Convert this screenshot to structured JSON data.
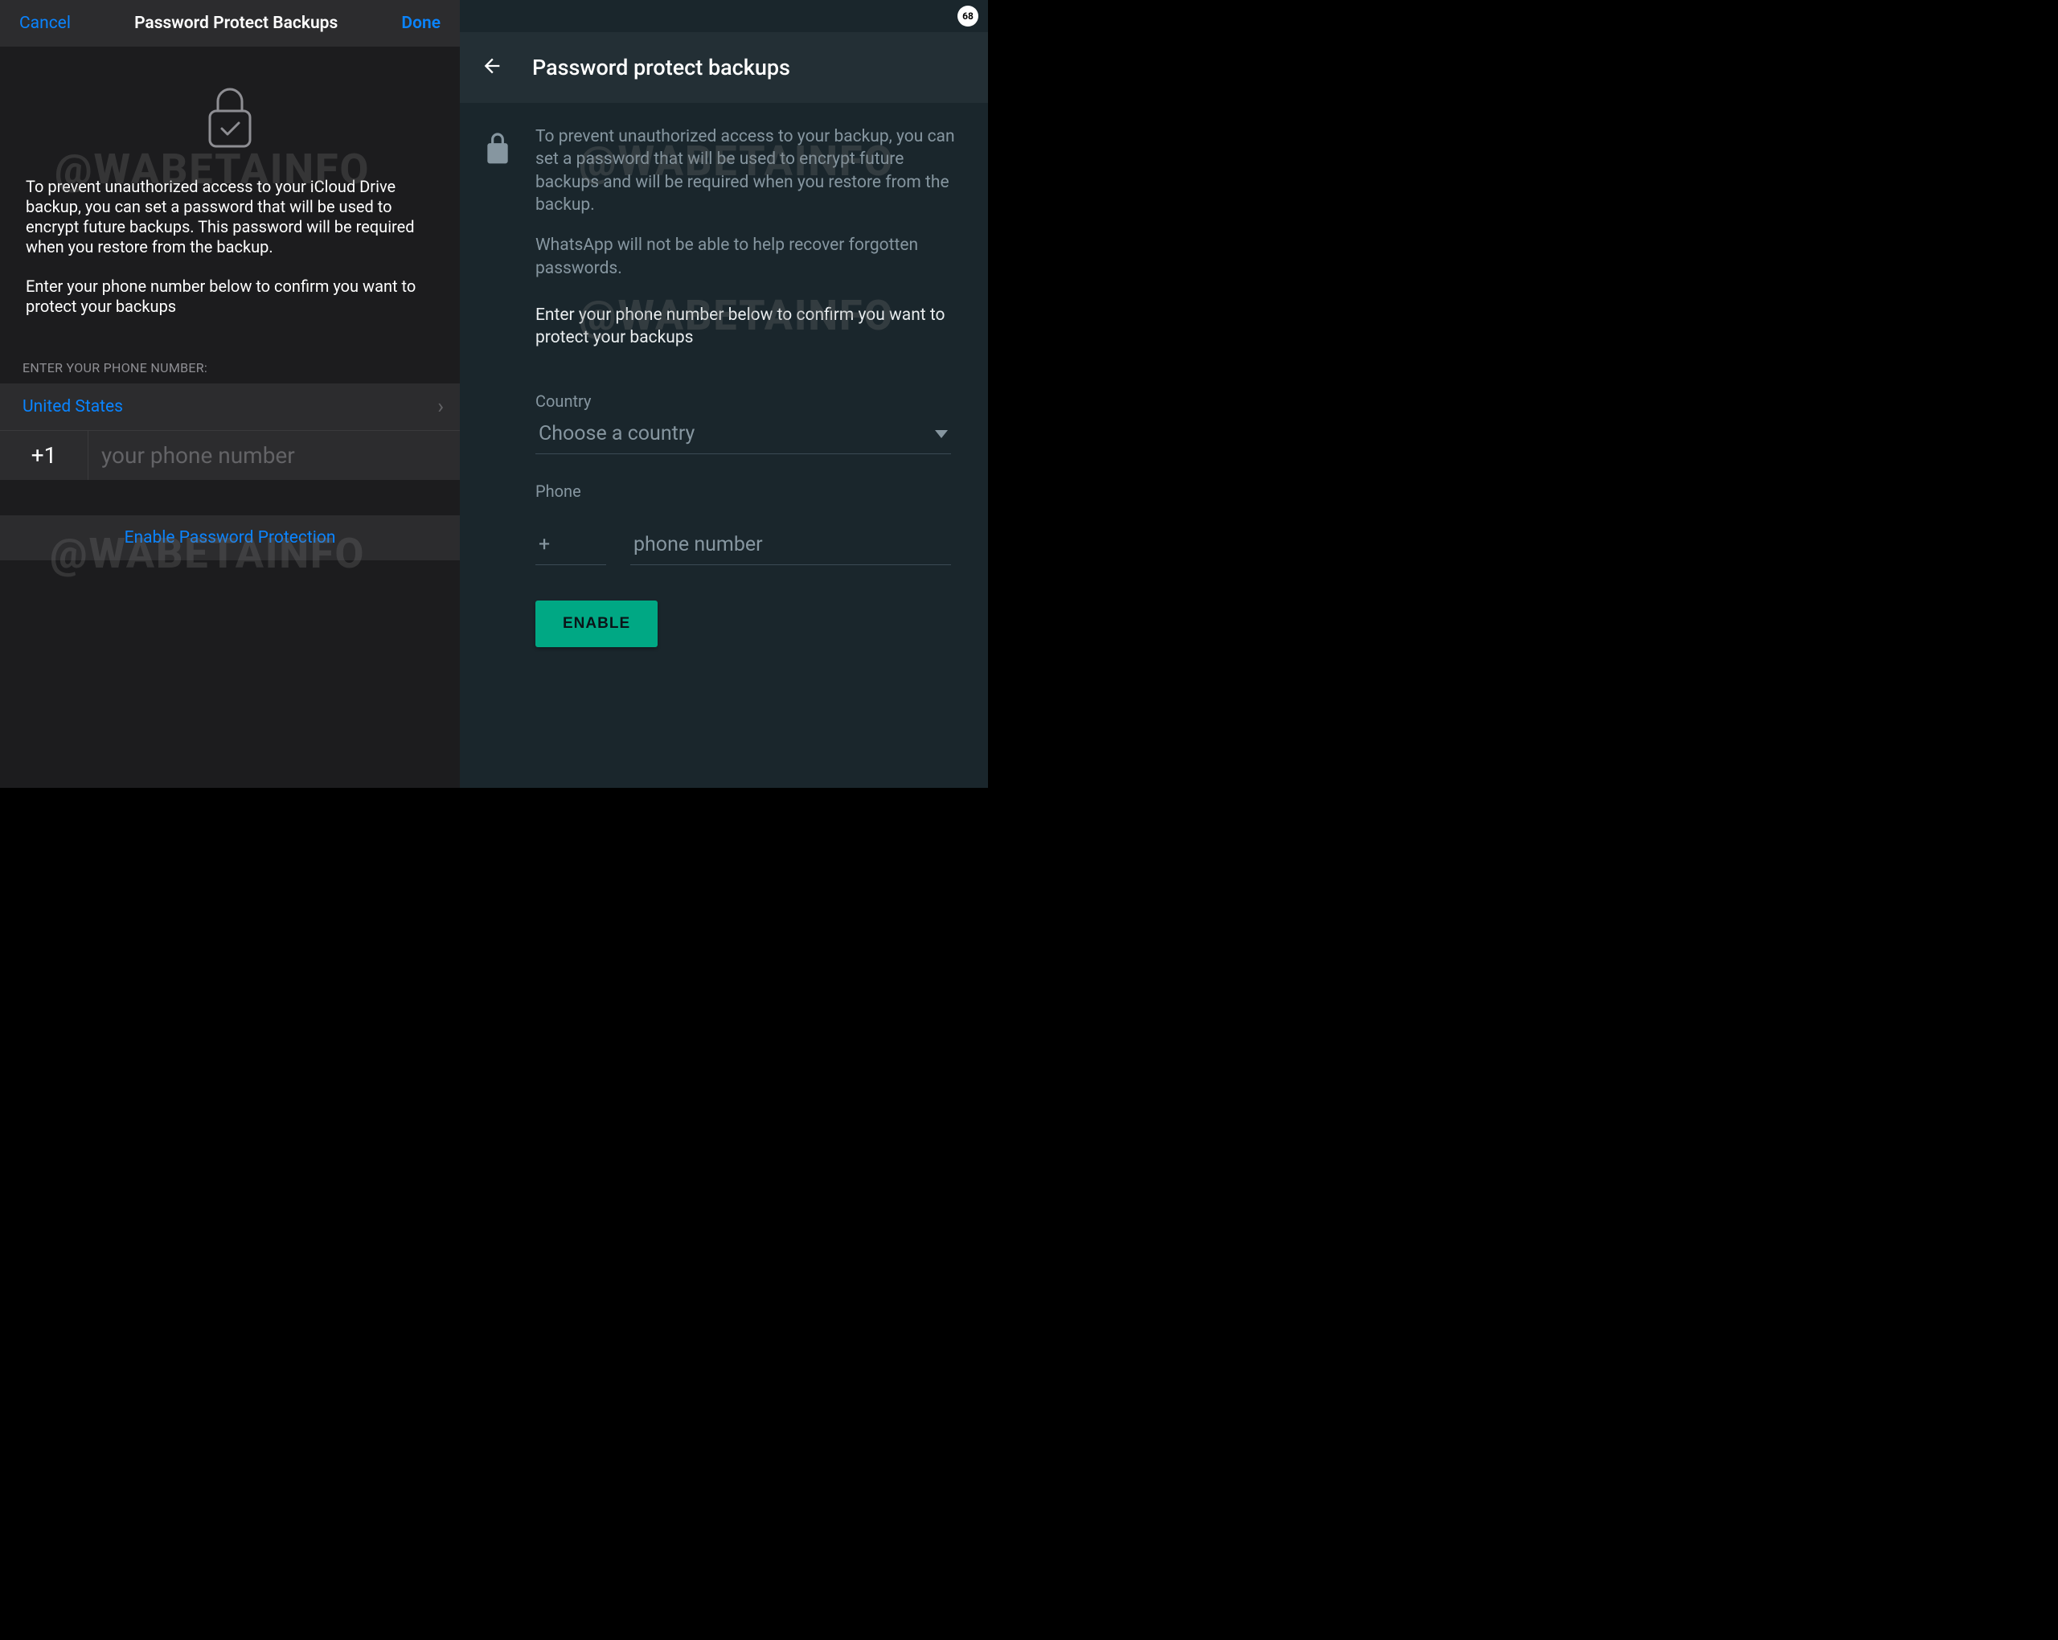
{
  "ios": {
    "cancel": "Cancel",
    "title": "Password Protect Backups",
    "done": "Done",
    "desc1": "To prevent unauthorized access to your iCloud Drive backup, you can set a password that will be used to encrypt future backups. This password will be required when you restore from the backup.",
    "desc2": "Enter your phone number below to confirm you want to protect your backups",
    "section_label": "ENTER YOUR PHONE NUMBER:",
    "country": "United States",
    "country_code": "+1",
    "phone_placeholder": "your phone number",
    "enable_label": "Enable Password Protection"
  },
  "android": {
    "badge": "68",
    "title": "Password protect backups",
    "desc1": "To prevent unauthorized access to your backup, you can set a password that will be used to encrypt future backups and will be required when you restore from the backup.",
    "desc2": "WhatsApp will not be able to help recover forgotten passwords.",
    "confirm": "Enter your phone number below to confirm you want to protect your backups",
    "country_label": "Country",
    "country_placeholder": "Choose a country",
    "phone_label": "Phone",
    "plus": "+",
    "phone_placeholder": "phone number",
    "enable_label": "ENABLE"
  },
  "watermark": "@WABETAINFO"
}
